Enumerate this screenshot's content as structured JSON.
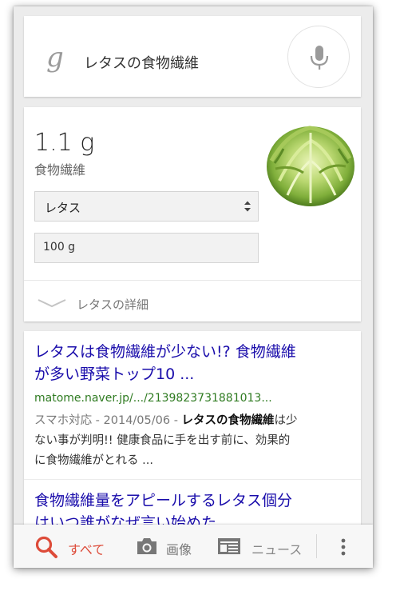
{
  "search": {
    "logo": "g",
    "query": "レタスの食物繊維"
  },
  "nutrition": {
    "amount": "1.1 g",
    "nutrient": "食物繊維",
    "food_select": "レタス",
    "quantity": "100 g",
    "detail_link": "レタスの詳細"
  },
  "results": [
    {
      "title_line1": "レタスは食物繊維が少ない!? 食物繊維",
      "title_line2": "が多い野菜トップ10 ...",
      "url": "matome.naver.jp/.../2139823731881013...",
      "meta": "スマホ対応 - 2014/05/06 - ",
      "snippet_bold": "レタスの食物繊維",
      "snippet_rest1": "は少",
      "snippet_line2": "ない事が判明!! 健康食品に手を出す前に、効果的",
      "snippet_line3": "に食物繊維がとれる ..."
    },
    {
      "title_line1": "食物繊維量をアピールするレタス個分",
      "title_line2": "はいつ誰がなぜ言い始めた ..."
    }
  ],
  "bottom_tabs": {
    "all": "すべて",
    "images": "画像",
    "news": "ニュース"
  },
  "colors": {
    "link": "#1a0dab",
    "url": "#2f7b21",
    "active_tab": "#dd4b39",
    "inactive_tab": "#777777"
  }
}
